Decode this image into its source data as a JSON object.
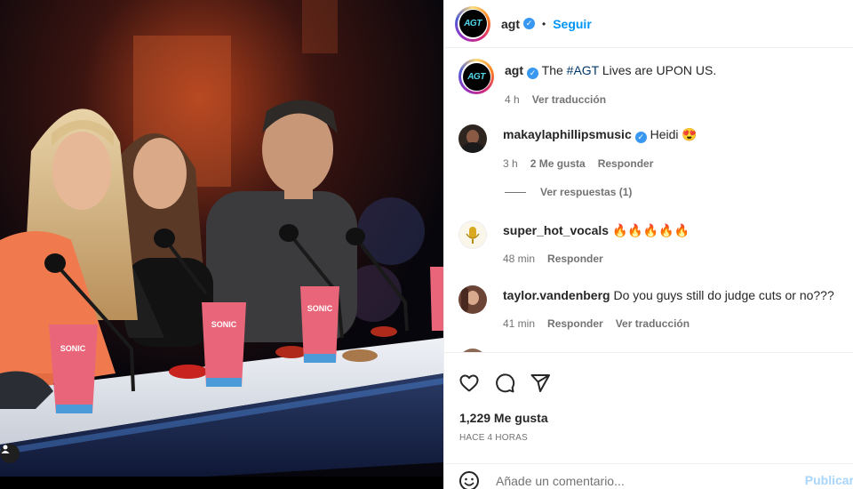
{
  "post": {
    "username": "agt",
    "follow_label": "Seguir",
    "avatar_text": "AGT",
    "dot": "•",
    "caption_prefix": "The ",
    "caption_hashtag": "#AGT",
    "caption_suffix": " Lives are UPON US.",
    "caption_time": "4 h",
    "caption_translate": "Ver traducción",
    "photo_cup_label": "SONIC"
  },
  "comments": [
    {
      "username": "makaylaphillipsmusic",
      "verified": true,
      "text": "Heidi 😍",
      "time": "3 h",
      "likes": "2 Me gusta",
      "reply": "Responder",
      "view_replies": "Ver respuestas (1)"
    },
    {
      "username": "super_hot_vocals",
      "text": "🔥🔥🔥🔥🔥",
      "time": "48 min",
      "reply": "Responder"
    },
    {
      "username": "taylor.vandenberg",
      "text": "Do you guys still do judge cuts or no???",
      "time": "41 min",
      "reply": "Responder",
      "translate": "Ver traducción"
    }
  ],
  "actions": {
    "like_count": "1,229 Me gusta",
    "time_ago": "HACE 4 HORAS",
    "icons": [
      "heart-icon",
      "comment-icon",
      "share-icon"
    ]
  },
  "compose": {
    "placeholder": "Añade un comentario...",
    "publish_label": "Publicar"
  },
  "colors": {
    "accent": "#0095f6",
    "verified": "#3897f0",
    "muted": "#737373"
  }
}
